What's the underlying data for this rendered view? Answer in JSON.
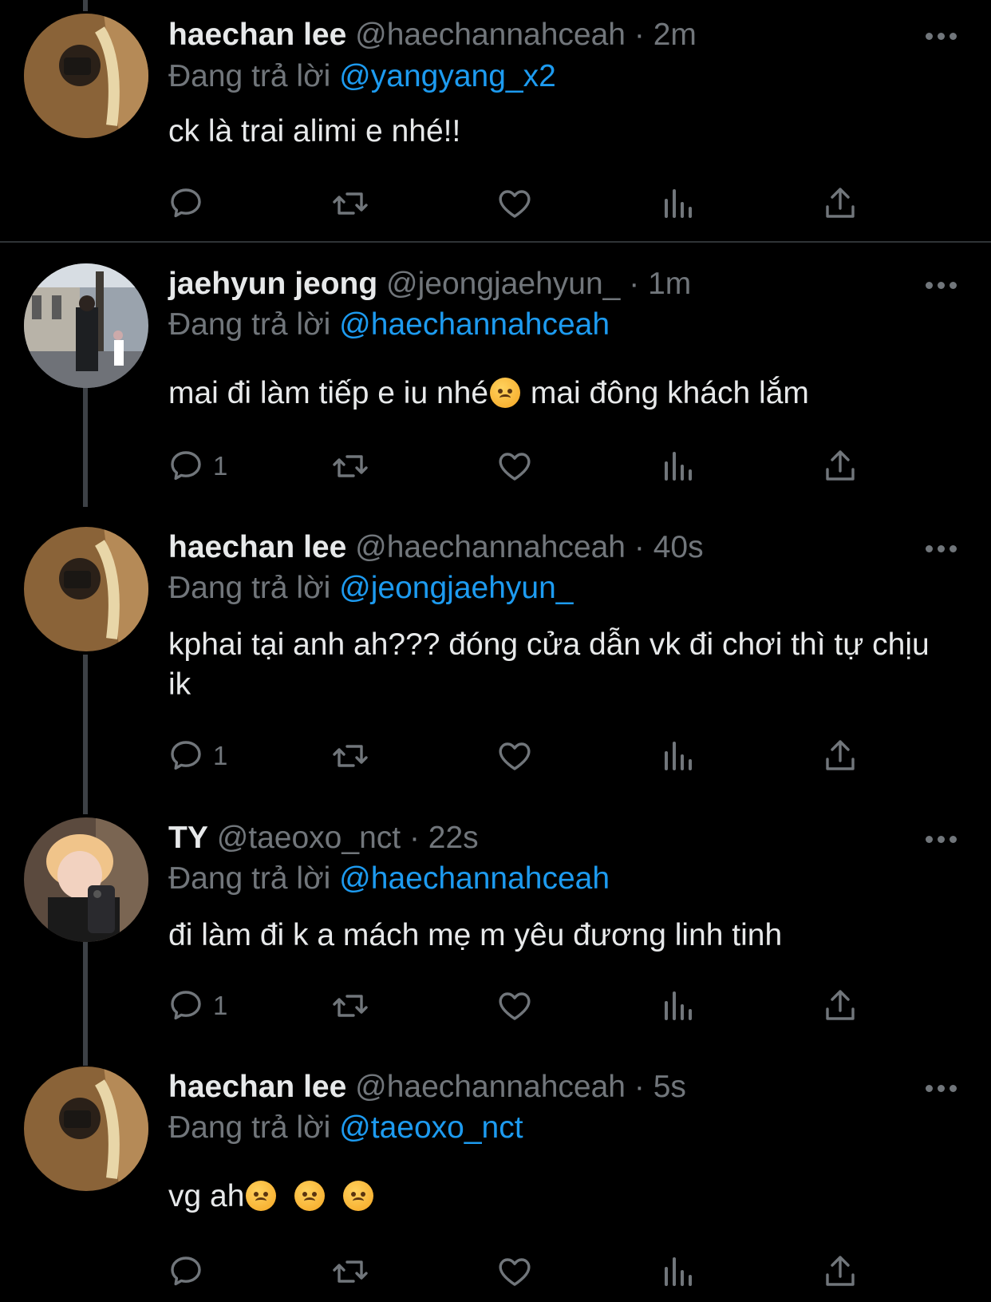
{
  "tweets": [
    {
      "name": "haechan lee",
      "handle": "@haechannahceah",
      "time": "2m",
      "reply_prefix": "Đang trả lời",
      "reply_to": "@yangyang_x2",
      "text": "ck là trai alimi e nhé!!",
      "reply_count": ""
    },
    {
      "name": "jaehyun jeong",
      "handle": "@jeongjaehyun_",
      "time": "1m",
      "reply_prefix": "Đang trả lời",
      "reply_to": "@haechannahceah",
      "text": "mai đi làm tiếp e iu nhé",
      "text_after_emoji": " mai đông khách lắm",
      "reply_count": "1"
    },
    {
      "name": "haechan lee",
      "handle": "@haechannahceah",
      "time": "40s",
      "reply_prefix": "Đang trả lời",
      "reply_to": "@jeongjaehyun_",
      "text": "kphai tại anh ah??? đóng cửa dẫn vk đi chơi thì tự chịu ik",
      "reply_count": "1"
    },
    {
      "name": "TY",
      "handle": "@taeoxo_nct",
      "time": "22s",
      "reply_prefix": "Đang trả lời",
      "reply_to": "@haechannahceah",
      "text": "đi làm đi k a mách mẹ m yêu đương linh tinh",
      "reply_count": "1"
    },
    {
      "name": "haechan lee",
      "handle": "@haechannahceah",
      "time": "5s",
      "reply_prefix": "Đang trả lời",
      "reply_to": "@taeoxo_nct",
      "text": "vg ah",
      "reply_count": ""
    }
  ],
  "separator": "·",
  "icons": [
    "reply-icon",
    "retweet-icon",
    "like-icon",
    "analytics-icon",
    "share-icon",
    "more-icon"
  ],
  "colors": {
    "background": "#000000",
    "mention": "#1d9bf0",
    "secondary": "#71767b",
    "thread_line": "#3d4146"
  }
}
